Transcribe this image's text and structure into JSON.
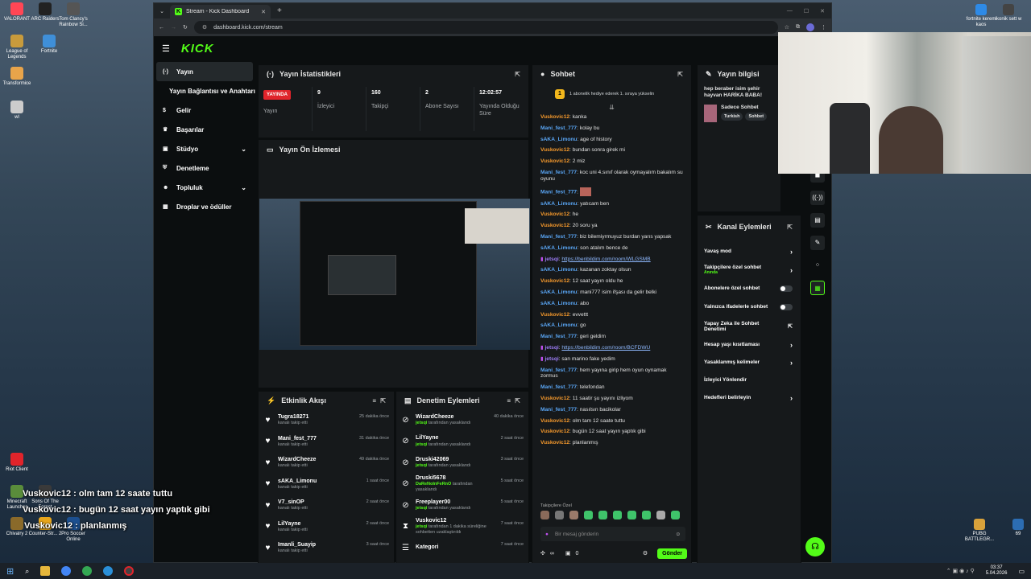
{
  "desktop": {
    "icons_left": [
      {
        "label": "VALORANT",
        "color": "#ff4655"
      },
      {
        "label": "ARC Raiders",
        "color": "#222"
      },
      {
        "label": "Tom Clancy's Rainbow Si...",
        "color": "#555"
      },
      {
        "label": "League of Legends",
        "color": "#c89b3c"
      },
      {
        "label": "Fortnite",
        "color": "#3f8fd8"
      },
      {
        "label": "Transformice",
        "color": "#e8a44a"
      },
      {
        "label": "wl",
        "color": "#cccccc"
      },
      {
        "label": "Riot Client",
        "color": "#e0242b"
      },
      {
        "label": "Minecraft Launcher",
        "color": "#5a8d3b"
      },
      {
        "label": "Sons Of The Forest",
        "color": "#3a3a3a"
      },
      {
        "label": "Chivalry 2",
        "color": "#8a6a2a"
      },
      {
        "label": "Counter-Str... 2",
        "color": "#e7a51c"
      },
      {
        "label": "Pro Soccer Online",
        "color": "#1c4f8f"
      }
    ],
    "icons_right": [
      {
        "label": "fortnite kerem kaos",
        "color": "#2e8ae6"
      },
      {
        "label": "ikonik sett w",
        "color": "#444"
      },
      {
        "label": "PUBG BATTLEGR...",
        "color": "#d9a23b"
      },
      {
        "label": "69",
        "color": "#2c6db3"
      }
    ],
    "overlay_chat": [
      "Vuskovic12 : olm tam 12 saate tuttu",
      "Vuskovic12 : bugün 12 saat yayın yaptık gibi",
      "Vuskovic12 : planlanmış"
    ]
  },
  "browser": {
    "tab_title": "Stream - Kick Dashboard",
    "url": "dashboard.kick.com/stream"
  },
  "kick": {
    "logo": "KICK",
    "nav": [
      {
        "label": "Yayın",
        "icon": "broadcast-icon",
        "active": true
      },
      {
        "label": "Yayın Bağlantısı ve Anahtarı",
        "icon": "",
        "active": false
      },
      {
        "label": "Gelir",
        "icon": "dollar-icon",
        "active": false
      },
      {
        "label": "Başarılar",
        "icon": "trophy-icon",
        "active": false
      },
      {
        "label": "Stüdyo",
        "icon": "studio-icon",
        "active": false,
        "chevron": true
      },
      {
        "label": "Denetleme",
        "icon": "shield-icon",
        "active": false
      },
      {
        "label": "Topluluk",
        "icon": "people-icon",
        "active": false,
        "chevron": true
      },
      {
        "label": "Droplar ve ödüller",
        "icon": "gift-icon",
        "active": false
      }
    ],
    "stats": {
      "title": "Yayın İstatistikleri",
      "items": [
        {
          "value": "YAYINDA",
          "label": "Yayın"
        },
        {
          "value": "9",
          "label": "İzleyici"
        },
        {
          "value": "160",
          "label": "Takipçi"
        },
        {
          "value": "2",
          "label": "Abone Sayısı"
        },
        {
          "value": "12:02:57",
          "label": "Yayında Olduğu Süre"
        }
      ]
    },
    "preview": {
      "title": "Yayın Ön İzlemesi"
    },
    "activity": {
      "title": "Etkinlik Akışı",
      "rows": [
        {
          "name": "Tugra18271",
          "sub": "kanalı takip etti",
          "time": "25 dakika önce"
        },
        {
          "name": "Mani_fest_777",
          "sub": "kanalı takip etti",
          "time": "31 dakika önce"
        },
        {
          "name": "WizardCheeze",
          "sub": "kanalı takip etti",
          "time": "49 dakika önce"
        },
        {
          "name": "sAKA_Limonu",
          "sub": "kanalı takip etti",
          "time": "1 saat önce"
        },
        {
          "name": "V7_sinOP",
          "sub": "kanalı takip etti",
          "time": "2 saat önce"
        },
        {
          "name": "LilYayne",
          "sub": "kanalı takip etti",
          "time": "2 saat önce"
        },
        {
          "name": "Imanli_Suayip",
          "sub": "kanalı takip etti",
          "time": "3 saat önce"
        }
      ]
    },
    "moderation": {
      "title": "Denetim Eylemleri",
      "rows": [
        {
          "name": "WizardCheeze",
          "by": "jetsqi",
          "sub": "tarafından yasaklandı",
          "time": "40 dakika önce",
          "icon": "ban-icon"
        },
        {
          "name": "LilYayne",
          "by": "jetsqi",
          "sub": "tarafından yasaklandı",
          "time": "2 saat önce",
          "icon": "ban-icon"
        },
        {
          "name": "Druski42069",
          "by": "jetsqi",
          "sub": "tarafından yasaklandı",
          "time": "3 saat önce",
          "icon": "ban-icon"
        },
        {
          "name": "Druski5678",
          "by": "DaReNoInFeRnO",
          "sub": "tarafından yasaklandı",
          "time": "5 saat önce",
          "icon": "ban-icon"
        },
        {
          "name": "Freeplayer00",
          "by": "jetsqi",
          "sub": "tarafından yasaklandı",
          "time": "5 saat önce",
          "icon": "ban-icon"
        },
        {
          "name": "Vuskovic12",
          "by": "jetsqi",
          "sub": "tarafından 1 dakika süreliğine sohbetten uzaklaştırıldı",
          "time": "7 saat önce",
          "icon": "hourglass-icon"
        },
        {
          "name": "Kategori",
          "by": "",
          "sub": "",
          "time": "7 saat önce",
          "icon": "list-icon"
        }
      ]
    },
    "chat": {
      "title": "Sohbet",
      "pinned": "1 abonelik hediye ederek 1. sıraya yükselin",
      "pinned_rank": "1",
      "messages": [
        {
          "user": "Vuskovic12",
          "cls": "u1",
          "text": "kanka"
        },
        {
          "user": "Mani_fest_777",
          "cls": "u2",
          "text": "kolay bu"
        },
        {
          "user": "sAKA_Limonu",
          "cls": "u2",
          "text": "age of history"
        },
        {
          "user": "Vuskovic12",
          "cls": "u1",
          "text": "bundan sonra girek mi"
        },
        {
          "user": "Vuskovic12",
          "cls": "u1",
          "text": "2 miz"
        },
        {
          "user": "Mani_fest_777",
          "cls": "u2",
          "text": "koc uni 4.sınıf olarak oymayalım bakalım su oyunu"
        },
        {
          "user": "Mani_fest_777",
          "cls": "u2",
          "text": "",
          "emote": true
        },
        {
          "user": "sAKA_Limonu",
          "cls": "u2",
          "text": "yatıcam ben"
        },
        {
          "user": "Vuskovic12",
          "cls": "u1",
          "text": "he"
        },
        {
          "user": "Vuskovic12",
          "cls": "u1",
          "text": "20 soru ya"
        },
        {
          "user": "Mani_fest_777",
          "cls": "u2",
          "text": "biz bilemiyrmuyuz burdan yarıs yapsak"
        },
        {
          "user": "sAKA_Limonu",
          "cls": "u2",
          "text": "son atalım bence de"
        },
        {
          "user": "jetsqi",
          "cls": "u3",
          "text": "https://benbildim.com/room/WLGSMB",
          "link": true,
          "badge": true
        },
        {
          "user": "sAKA_Limonu",
          "cls": "u2",
          "text": "kazanan zoktay olsun"
        },
        {
          "user": "Vuskovic12",
          "cls": "u1",
          "text": "12 saat yayın oldu he"
        },
        {
          "user": "sAKA_Limonu",
          "cls": "u2",
          "text": "mani777 isim ifşası da gelir belki"
        },
        {
          "user": "sAKA_Limonu",
          "cls": "u2",
          "text": "abo"
        },
        {
          "user": "Vuskovic12",
          "cls": "u1",
          "text": "evvettt"
        },
        {
          "user": "sAKA_Limonu",
          "cls": "u2",
          "text": "go"
        },
        {
          "user": "Mani_fest_777",
          "cls": "u2",
          "text": "geri geldim"
        },
        {
          "user": "jetsqi",
          "cls": "u3",
          "text": "https://benbildim.com/room/BCFDWU",
          "link": true,
          "badge": true
        },
        {
          "user": "jetsqi",
          "cls": "u3",
          "text": "san marino fake yedim",
          "badge": true
        },
        {
          "user": "Mani_fest_777",
          "cls": "u2",
          "text": "hem yayına girip hem oyun oynamak zormus"
        },
        {
          "user": "Mani_fest_777",
          "cls": "u2",
          "text": "telefondan"
        },
        {
          "user": "Vuskovic12",
          "cls": "u1",
          "text": "11 saatir şu yayını izliyom"
        },
        {
          "user": "Mani_fest_777",
          "cls": "u2",
          "text": "nasılsın bacikolar"
        },
        {
          "user": "Vuskovic12",
          "cls": "u1",
          "text": "olm tam 12 saate tuttu"
        },
        {
          "user": "Vuskovic12",
          "cls": "u1",
          "text": "bugün 12 saat yayın yaptık gibi"
        },
        {
          "user": "Vuskovic12",
          "cls": "u1",
          "text": "planlanmış"
        }
      ],
      "emote_label": "Takipçilere Özel",
      "input_placeholder": "Bir mesaj gönderin",
      "count_infinity": "∞",
      "count_zero": "0",
      "send_label": "Gönder"
    },
    "stream_info": {
      "title": "Yayın bilgisi",
      "stream_title": "hep beraber isim şehir hayvan HARİKA BABA!",
      "category": "Sadece Sohbet",
      "tags": [
        "Turkish",
        "Sohbet"
      ]
    },
    "channel_actions": {
      "title": "Kanal Eylemleri",
      "rows": [
        {
          "label": "Yavaş mod",
          "control": "chevron"
        },
        {
          "label": "Takipçilere özel sohbet",
          "sub": "Anında",
          "control": "chevron"
        },
        {
          "label": "Abonelere özel sohbet",
          "control": "toggle"
        },
        {
          "label": "Yalnızca ifadelerle sohbet",
          "control": "toggle"
        },
        {
          "label": "Yapay Zeka ile Sohbet Denetimi",
          "control": "external"
        },
        {
          "label": "Hesap yaşı kısıtlaması",
          "control": "chevron"
        },
        {
          "label": "Yasaklanmış kelimeler",
          "control": "chevron"
        },
        {
          "label": "İzleyici Yönlendir",
          "control": "none"
        },
        {
          "label": "Hedefleri belirleyin",
          "control": "chevron"
        }
      ]
    }
  },
  "taskbar": {
    "time": "03:37",
    "date": "5.04.2026"
  },
  "colors": {
    "kick_green": "#53fc18",
    "live_red": "#e0242b"
  }
}
